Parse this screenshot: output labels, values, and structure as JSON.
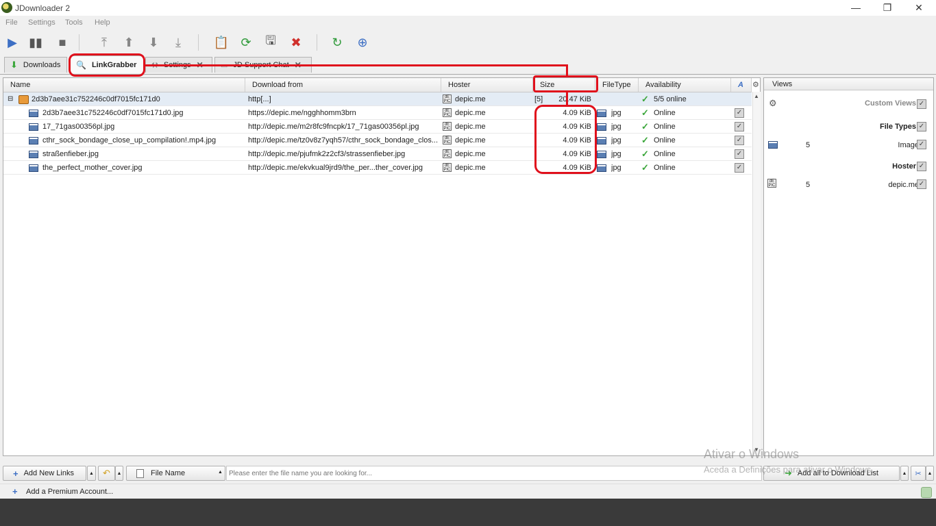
{
  "window": {
    "title": "JDownloader 2",
    "min": "—",
    "max": "❐",
    "close": "✕"
  },
  "menu": [
    "File",
    "Settings",
    "Tools",
    "Help"
  ],
  "tabs": [
    {
      "label": "Downloads"
    },
    {
      "label": "LinkGrabber"
    },
    {
      "label": "Settings"
    },
    {
      "label": "JD Support Chat"
    }
  ],
  "columns": [
    "Name",
    "Download from",
    "Hoster",
    "Size",
    "FileType",
    "Availability"
  ],
  "package": {
    "name": "2d3b7aee31c752246c0df7015fc171d0",
    "download_from": "http[...]",
    "hoster": "depic.me",
    "count": "[5]",
    "size": "20.47 KiB",
    "availability": "5/5 online"
  },
  "rows": [
    {
      "name": "2d3b7aee31c752246c0df7015fc171d0.jpg",
      "from": "https://depic.me/ngghhomm3brn",
      "hoster": "depic.me",
      "size": "4.09 KiB",
      "type": "jpg",
      "avail": "Online"
    },
    {
      "name": "17_71gas00356pl.jpg",
      "from": "http://depic.me/m2r8fc9fncpk/17_71gas00356pl.jpg",
      "hoster": "depic.me",
      "size": "4.09 KiB",
      "type": "jpg",
      "avail": "Online"
    },
    {
      "name": "cthr_sock_bondage_close_up_compilation!.mp4.jpg",
      "from": "http://depic.me/tz0v8z7yqh57/cthr_sock_bondage_clos...",
      "hoster": "depic.me",
      "size": "4.09 KiB",
      "type": "jpg",
      "avail": "Online"
    },
    {
      "name": "straßenfieber.jpg",
      "from": "http://depic.me/pjufmk2z2cf3/strassenfieber.jpg",
      "hoster": "depic.me",
      "size": "4.09 KiB",
      "type": "jpg",
      "avail": "Online"
    },
    {
      "name": "the_perfect_mother_cover.jpg",
      "from": "http://depic.me/ekvkual9jrd9/the_per...ther_cover.jpg",
      "hoster": "depic.me",
      "size": "4.09 KiB",
      "type": "jpg",
      "avail": "Online"
    }
  ],
  "views": {
    "title": "Views",
    "custom_views": "Custom Views",
    "file_types": "File Types",
    "image_count": "5",
    "image_label": "Image",
    "hoster": "Hoster",
    "hoster_count": "5",
    "hoster_label": "depic.me"
  },
  "bottom": {
    "add_links": "Add New Links",
    "search_field": "File Name",
    "search_placeholder": "Please enter the file name you are looking for...",
    "add_all": "Add all to Download List"
  },
  "status": {
    "premium": "Add a Premium Account..."
  },
  "watermark": {
    "line1": "Ativar o Windows",
    "line2": "Aceda a Definições para ativar o Windows."
  },
  "colors": {
    "annotation": "#e0101c",
    "package_row": "#e4ecf5",
    "online_check": "#3aa63a"
  }
}
